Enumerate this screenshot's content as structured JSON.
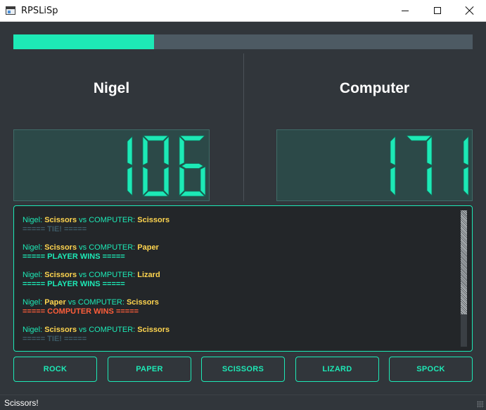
{
  "window": {
    "title": "RPSLiSp"
  },
  "progress": {
    "fraction": 0.306,
    "color": "#1de9b6"
  },
  "players": {
    "p1": {
      "name": "Nigel",
      "score": "106"
    },
    "p2": {
      "name": "Computer",
      "score": "171"
    }
  },
  "log": {
    "entries": [
      {
        "player": "Nigel",
        "player_move": "Scissors",
        "vs_label": "vs COMPUTER:",
        "computer_move": "Scissors",
        "result": "===== TIE! =====",
        "result_type": "tie"
      },
      {
        "player": "Nigel",
        "player_move": "Scissors",
        "vs_label": "vs COMPUTER:",
        "computer_move": "Paper",
        "result": "===== PLAYER WINS =====",
        "result_type": "player"
      },
      {
        "player": "Nigel",
        "player_move": "Scissors",
        "vs_label": "vs COMPUTER:",
        "computer_move": "Lizard",
        "result": "===== PLAYER WINS =====",
        "result_type": "player"
      },
      {
        "player": "Nigel",
        "player_move": "Paper",
        "vs_label": "vs COMPUTER:",
        "computer_move": "Scissors",
        "result": "===== COMPUTER WINS =====",
        "result_type": "computer"
      },
      {
        "player": "Nigel",
        "player_move": "Scissors",
        "vs_label": "vs COMPUTER:",
        "computer_move": "Scissors",
        "result": "===== TIE! =====",
        "result_type": "tie"
      }
    ]
  },
  "buttons": {
    "rock": "ROCK",
    "paper": "PAPER",
    "scissors": "SCISSORS",
    "lizard": "LIZARD",
    "spock": "SPOCK"
  },
  "status": {
    "text": "Scissors!"
  },
  "colors": {
    "accent": "#1de9b6",
    "move": "#ffd54f",
    "computer_win": "#ff5e3a",
    "tie": "#3d5a66",
    "background": "#31363b"
  }
}
